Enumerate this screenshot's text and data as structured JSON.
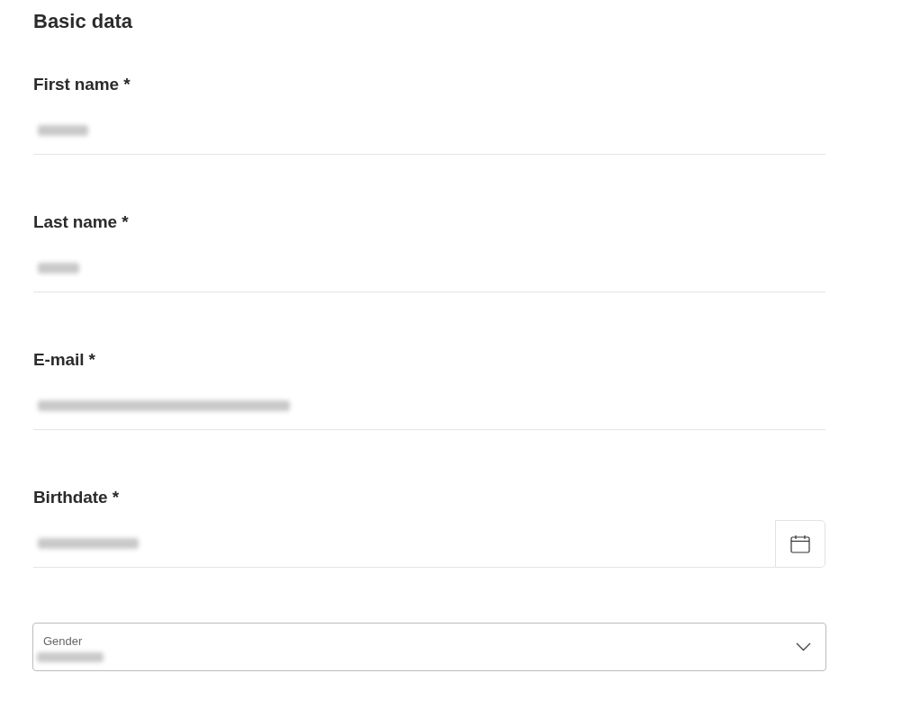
{
  "section": {
    "title": "Basic data"
  },
  "fields": [
    {
      "kind": "text",
      "label": "First name *",
      "redacted": true
    },
    {
      "kind": "text",
      "label": "Last name *",
      "redacted": true
    },
    {
      "kind": "text",
      "label": "E-mail *",
      "redacted": true
    },
    {
      "kind": "date",
      "label": "Birthdate *",
      "redacted": true
    },
    {
      "kind": "select",
      "label": "Gender",
      "redacted": true
    }
  ]
}
